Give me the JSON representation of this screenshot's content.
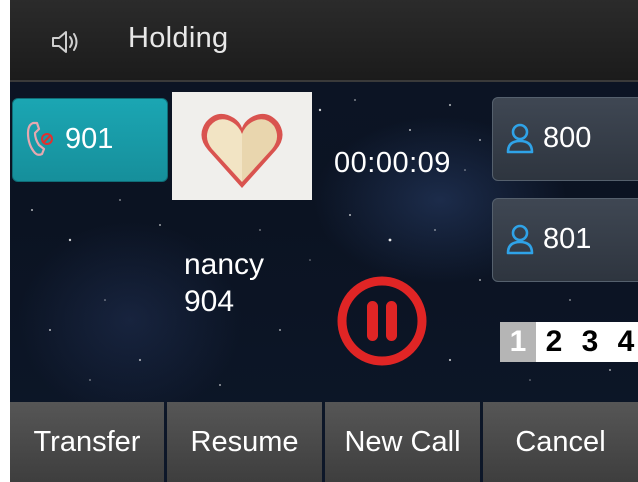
{
  "header": {
    "title": "Holding",
    "icon": "speaker-icon"
  },
  "line_keys": {
    "active": {
      "label": "901",
      "icon": "handset-icon",
      "color": "#1ba6b3"
    },
    "right": [
      {
        "label": "800",
        "icon": "contact-icon"
      },
      {
        "label": "801",
        "icon": "contact-icon"
      }
    ]
  },
  "call": {
    "duration": "00:00:09",
    "caller_name": "nancy",
    "caller_number": "904",
    "avatar_icon": "heart-icon",
    "status_icon": "hold-icon",
    "status_color": "#e02525"
  },
  "pager": {
    "pages": [
      "1",
      "2",
      "3",
      "4"
    ],
    "active_index": 0
  },
  "softkeys": [
    "Transfer",
    "Resume",
    "New Call",
    "Cancel"
  ]
}
